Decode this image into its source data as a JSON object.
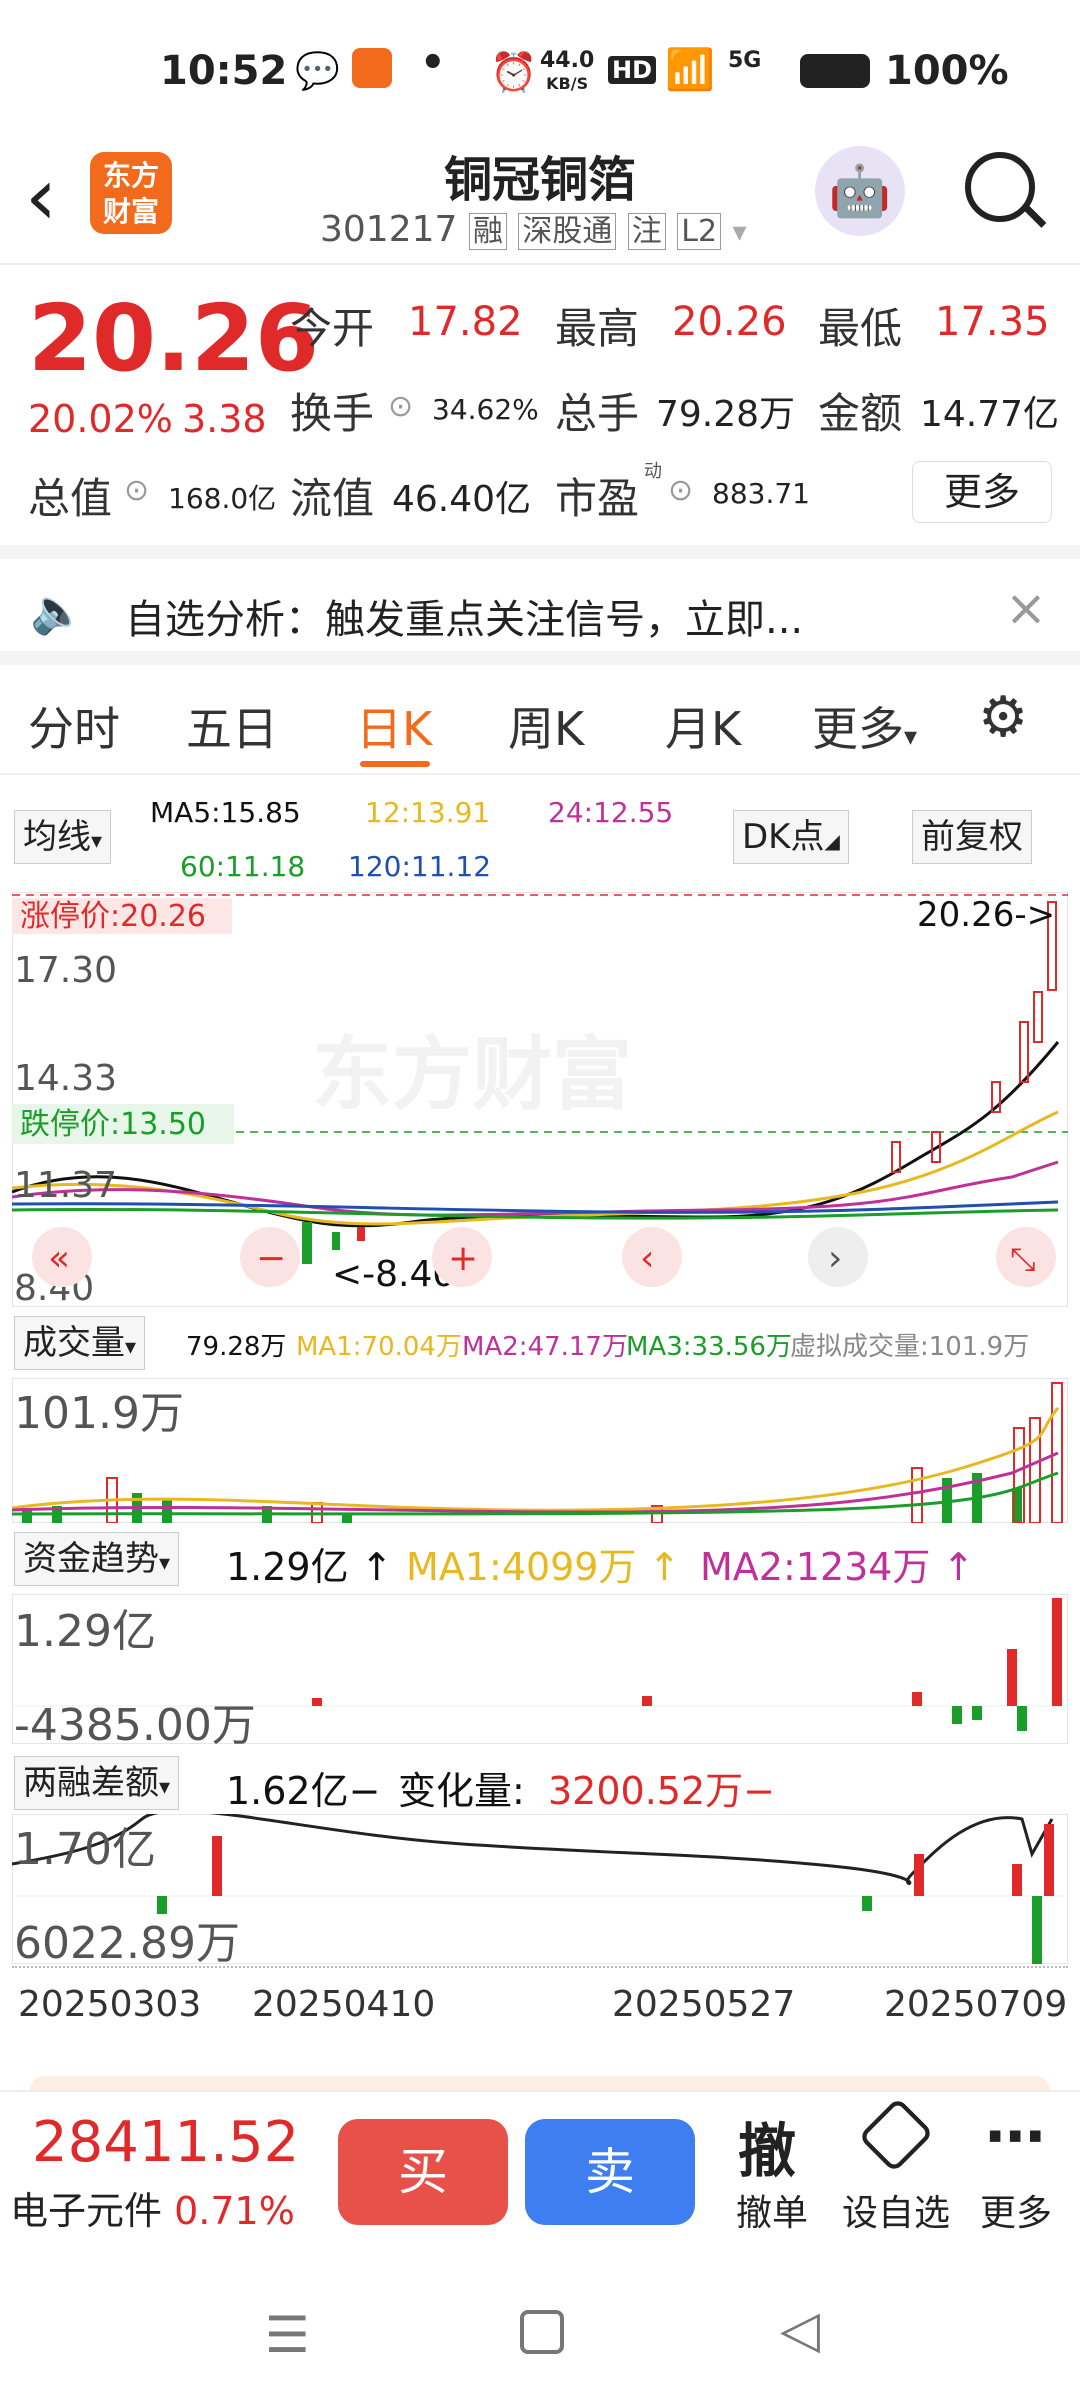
{
  "status": {
    "time": "10:52",
    "net_speed_top": "44.0",
    "net_speed_bottom": "KB/S",
    "hd": "HD",
    "net": "5G",
    "battery": "100%"
  },
  "nav": {
    "title": "铜冠铜箔",
    "code": "301217",
    "tags": [
      "融",
      "深股通",
      "注",
      "L2"
    ],
    "logo_text_1": "东方",
    "logo_text_2": "财富"
  },
  "quote": {
    "price": "20.26",
    "change_pct": "20.02%",
    "change": "3.38",
    "open_label": "今开",
    "open": "17.82",
    "high_label": "最高",
    "high": "20.26",
    "low_label": "最低",
    "low": "17.35",
    "turnover_label": "换手",
    "turnover": "34.62%",
    "volume_label": "总手",
    "volume": "79.28万",
    "amount_label": "金额",
    "amount": "14.77亿",
    "mktcap_label": "总值",
    "mktcap": "168.0亿",
    "float_label": "流值",
    "float": "46.40亿",
    "pe_label": "市盈",
    "pe_sup": "动",
    "pe": "883.71",
    "more": "更多"
  },
  "banner": {
    "text": "自选分析：触发重点关注信号，立即..."
  },
  "tabs": [
    "分时",
    "五日",
    "日K",
    "周K",
    "月K",
    "更多"
  ],
  "kline": {
    "ma_select": "均线",
    "ma5": "MA5:15.85",
    "ma12": "12:13.91",
    "ma24": "24:12.55",
    "ma60": "60:11.18",
    "ma120": "120:11.12",
    "dk": "DK点",
    "fq": "前复权",
    "limit_up": "涨停价:20.26",
    "price_tag": "20.26->",
    "y1": "17.30",
    "y2": "14.33",
    "limit_down": "跌停价:13.50",
    "y3": "11.37",
    "y4": "8.40",
    "low_tag": "<-8.40",
    "watermark": "东方财富"
  },
  "volume": {
    "select": "成交量",
    "val": "79.28万",
    "ma1": "MA1:70.04万",
    "ma2": "MA2:47.17万",
    "ma3": "MA3:33.56万",
    "virtual": "虚拟成交量:101.9万",
    "ymax": "101.9万"
  },
  "fund": {
    "select": "资金趋势",
    "val": "1.29亿",
    "ma1": "MA1:4099万",
    "ma2": "MA2:1234万",
    "ymax": "1.29亿",
    "ymin": "-4385.00万"
  },
  "margin": {
    "select": "两融差额",
    "val": "1.62亿",
    "change_label": "变化量:",
    "change": "3200.52万",
    "ymax": "1.70亿",
    "ymin": "6022.89万"
  },
  "dates": [
    "20250303",
    "20250410",
    "20250527",
    "20250709"
  ],
  "bottom": {
    "index_val": "28411.52",
    "index_name": "电子元件",
    "index_pct": "0.71%",
    "buy": "买",
    "sell": "卖",
    "cancel_icon": "撤",
    "cancel": "撤单",
    "watch": "设自选",
    "more": "更多"
  },
  "colors": {
    "up": "#e02a2a",
    "down": "#1a9e2a",
    "ma5": "#111111",
    "ma12": "#e8b820",
    "ma24": "#c0309a",
    "ma60": "#1a9e2a",
    "ma120": "#1f4fb0",
    "accent": "#f26a1b"
  }
}
